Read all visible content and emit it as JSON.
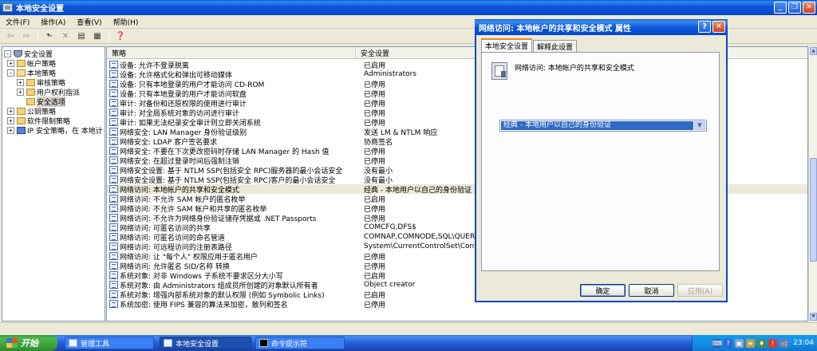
{
  "window": {
    "title": "本地安全设置"
  },
  "menu": [
    "文件(F)",
    "操作(A)",
    "查看(V)",
    "帮助(H)"
  ],
  "tree": {
    "items": [
      {
        "label": "安全设置",
        "expander": "-",
        "icon": "shield",
        "level": 0
      },
      {
        "label": "帐户策略",
        "expander": "+",
        "icon": "folder",
        "level": 1
      },
      {
        "label": "本地策略",
        "expander": "-",
        "icon": "open-folder",
        "level": 1
      },
      {
        "label": "审核策略",
        "expander": "+",
        "icon": "folder",
        "level": 2
      },
      {
        "label": "用户权利指派",
        "expander": "+",
        "icon": "folder",
        "level": 2
      },
      {
        "label": "安全选项",
        "expander": "",
        "icon": "folder",
        "level": 2,
        "selected": true
      },
      {
        "label": "公钥策略",
        "expander": "+",
        "icon": "folder",
        "level": 1
      },
      {
        "label": "软件限制策略",
        "expander": "+",
        "icon": "folder",
        "level": 1
      },
      {
        "label": "IP 安全策略，在 本地计",
        "expander": "+",
        "icon": "ip",
        "level": 1
      }
    ]
  },
  "list": {
    "columns": {
      "policy": "策略",
      "setting": "安全设置"
    },
    "rows": [
      {
        "policy": "设备: 允许不登录脱离",
        "setting": "已启用"
      },
      {
        "policy": "设备: 允许格式化和弹出可移动媒体",
        "setting": "Administrators"
      },
      {
        "policy": "设备: 只有本地登录的用户才能访问 CD-ROM",
        "setting": "已停用"
      },
      {
        "policy": "设备: 只有本地登录的用户才能访问软盘",
        "setting": "已停用"
      },
      {
        "policy": "审计: 对备份和还原权限的使用进行审计",
        "setting": "已停用"
      },
      {
        "policy": "审计: 对全局系统对象的访问进行审计",
        "setting": "已停用"
      },
      {
        "policy": "审计: 如果无法纪录安全审计则立即关闭系统",
        "setting": "已停用"
      },
      {
        "policy": "网络安全: LAN Manager 身份验证级别",
        "setting": "发送 LM & NTLM 响应"
      },
      {
        "policy": "网络安全: LDAP 客户签名要求",
        "setting": "协商签名"
      },
      {
        "policy": "网络安全: 不要在下次更改密码时存储 LAN Manager 的 Hash 值",
        "setting": "已停用"
      },
      {
        "policy": "网络安全: 在超过登录时间后强制注销",
        "setting": "已停用"
      },
      {
        "policy": "网络安全设置: 基于 NTLM SSP(包括安全 RPC)服务器的最小会话安全",
        "setting": "没有最小"
      },
      {
        "policy": "网络安全设置: 基于 NTLM SSP(包括安全 RPC)客户的最小会话安全",
        "setting": "没有最小"
      },
      {
        "policy": "网络访问: 本地帐户的共享和安全模式",
        "setting": "经典 - 本地用户以自己的身份验证",
        "highlight": true
      },
      {
        "policy": "网络访问: 不允许 SAM 帐户的匿名枚举",
        "setting": "已启用"
      },
      {
        "policy": "网络访问: 不允许 SAM 帐户和共享的匿名枚举",
        "setting": "已停用"
      },
      {
        "policy": "网络访问: 不允许为网络身份验证储存凭据或 .NET Passports",
        "setting": "已停用"
      },
      {
        "policy": "网络访问: 可匿名访问的共享",
        "setting": "COMCFG,DFS$"
      },
      {
        "policy": "网络访问: 可匿名访问的命名管道",
        "setting": "COMNAP,COMNODE,SQL\\QUERY,SPOOLSS"
      },
      {
        "policy": "网络访问: 可远程访问的注册表路径",
        "setting": "System\\CurrentControlSet\\Control"
      },
      {
        "policy": "网络访问: 让 \"每个人\" 权限应用于匿名用户",
        "setting": "已停用"
      },
      {
        "policy": "网络访问: 允许匿名 SID/名称 转换",
        "setting": "已停用"
      },
      {
        "policy": "系统对象: 对非 Windows 子系统不要求区分大小写",
        "setting": "已启用"
      },
      {
        "policy": "系统对象: 由 Administrators 组成员所创建的对象默认所有者",
        "setting": "Object creator"
      },
      {
        "policy": "系统对象: 增强内部系统对象的默认权限 (例如 Symbolic Links)",
        "setting": "已启用"
      },
      {
        "policy": "系统加密: 使用 FIPS 兼容的算法来加密，散列和签名",
        "setting": "已停用"
      }
    ]
  },
  "dialog": {
    "title": "网络访问: 本地帐户的共享和安全模式 属性",
    "tabs": [
      "本地安全设置",
      "解释此设置"
    ],
    "label": "网络访问: 本地帐户的共享和安全模式",
    "combo_value": "经典 - 本地用户以自己的身份验证",
    "buttons": {
      "ok": "确定",
      "cancel": "取消",
      "apply": "应用(A)"
    }
  },
  "taskbar": {
    "start": "开始",
    "tasks": [
      "管理工具",
      "本地安全设置",
      "命令提示符"
    ],
    "clock": "23:04"
  }
}
